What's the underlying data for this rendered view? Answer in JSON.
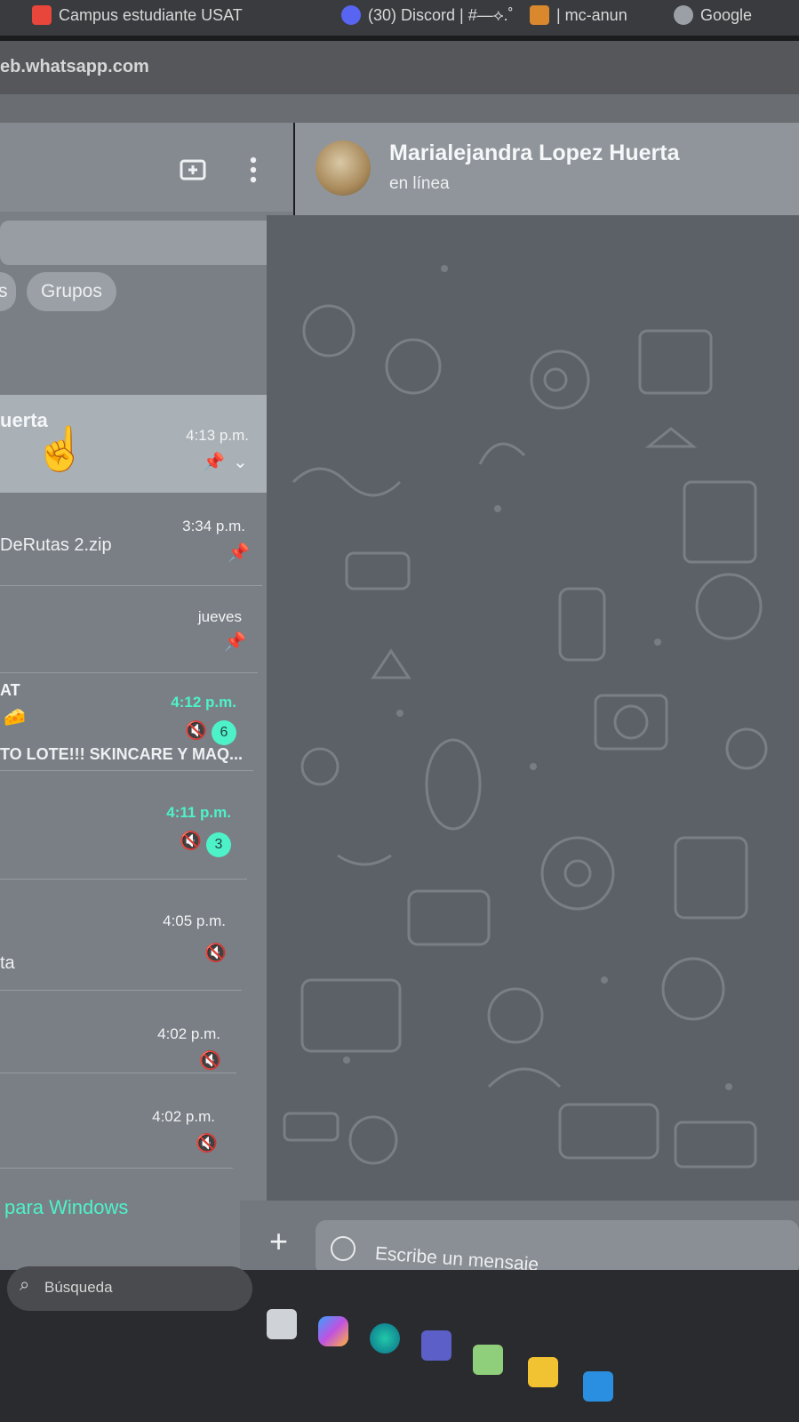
{
  "browser": {
    "tabs": [
      {
        "label": "Campus estudiante USAT",
        "fav_color": "#e8463a"
      },
      {
        "label": "(30) Discord | #—⟡.˚",
        "fav_color": "#5865f2"
      },
      {
        "label": "| mc-anun",
        "fav_color": "#d9882e"
      },
      {
        "label": "Google",
        "fav_color": "#9aa0a6"
      }
    ],
    "url": "eb.whatsapp.com"
  },
  "sidebar": {
    "filters": [
      "s",
      "Grupos"
    ],
    "chats": [
      {
        "name": "uerta",
        "snippet": "",
        "time": "4:13 p.m.",
        "time_green": false,
        "pinned": true,
        "chevron": true,
        "muted": false,
        "unread": ""
      },
      {
        "name": "",
        "snippet": "DeRutas 2.zip",
        "time": "3:34 p.m.",
        "time_green": false,
        "pinned": true,
        "chevron": false,
        "muted": false,
        "unread": ""
      },
      {
        "name": "",
        "snippet": "",
        "time": "jueves",
        "time_green": false,
        "pinned": true,
        "chevron": false,
        "muted": false,
        "unread": ""
      },
      {
        "name": "AT",
        "snippet": "🧀",
        "snippet2": "TO LOTE!!! SKINCARE Y MAQ...",
        "time": "4:12 p.m.",
        "time_green": true,
        "pinned": false,
        "chevron": false,
        "muted": true,
        "unread": "6"
      },
      {
        "name": "",
        "snippet": "",
        "time": "4:11 p.m.",
        "time_green": true,
        "pinned": false,
        "chevron": false,
        "muted": true,
        "unread": "3"
      },
      {
        "name": "",
        "snippet": "ta",
        "time": "4:05 p.m.",
        "time_green": false,
        "pinned": false,
        "chevron": false,
        "muted": true,
        "unread": ""
      },
      {
        "name": "",
        "snippet": "",
        "time": "4:02 p.m.",
        "time_green": false,
        "pinned": false,
        "chevron": false,
        "muted": true,
        "unread": ""
      },
      {
        "name": "",
        "snippet": "",
        "time": "4:02 p.m.",
        "time_green": false,
        "pinned": false,
        "chevron": false,
        "muted": true,
        "unread": ""
      }
    ],
    "footer_link": "para Windows"
  },
  "chat": {
    "contact_name": "Marialejandra Lopez Huerta",
    "contact_status": "en línea",
    "composer_placeholder": "Escribe un mensaje"
  },
  "taskbar": {
    "search_label": "Búsqueda",
    "apps": [
      "file-explorer-icon",
      "copilot-icon",
      "edge-icon",
      "teams-icon",
      "notepad-icon",
      "folder-icon",
      "vscode-icon"
    ]
  },
  "colors": {
    "accent": "#4ef2c8",
    "sidebar_bg": "#7a7f86",
    "chat_bg": "#5c6167"
  }
}
